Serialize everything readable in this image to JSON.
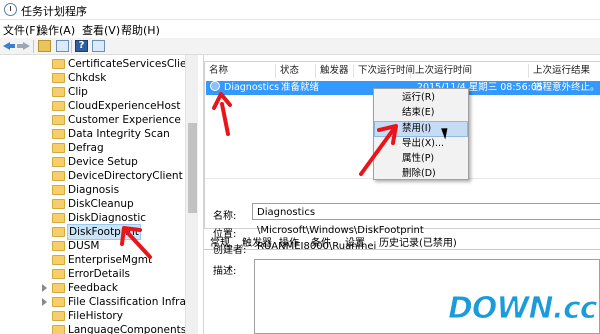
{
  "window": {
    "title": "任务计划程序"
  },
  "menu": [
    "文件(F)",
    "操作(A)",
    "查看(V)",
    "帮助(H)"
  ],
  "toolbar": {
    "help_label": "?"
  },
  "tree": [
    "CertificateServicesClient",
    "Chkdsk",
    "Clip",
    "CloudExperienceHost",
    "Customer Experience Improv",
    "Data Integrity Scan",
    "Defrag",
    "Device Setup",
    "DeviceDirectoryClient",
    "Diagnosis",
    "DiskCleanup",
    "DiskDiagnostic",
    "DiskFootprint",
    "DUSM",
    "EnterpriseMgmt",
    "ErrorDetails",
    "Feedback",
    "File Classification Infrastructu",
    "FileHistory",
    "LanguageComponentsInstall"
  ],
  "tree_selected": "DiskFootprint",
  "columns": [
    "名称",
    "状态",
    "触发器",
    "下次运行时间",
    "上次运行时间",
    "上次运行结果"
  ],
  "task": {
    "name": "Diagnostics",
    "status": "准备就绪",
    "last_run": "2015/11/4 星期三 08:56:05",
    "last_result": "进程意外终止。"
  },
  "context_menu": [
    "运行(R)",
    "结束(E)",
    "禁用(I)",
    "导出(X)...",
    "属性(P)",
    "删除(D)"
  ],
  "context_menu_highlighted": "禁用(I)",
  "tabs": [
    "常规",
    "触发器",
    "操作",
    "条件",
    "设置",
    "历史记录(已禁用)"
  ],
  "details": {
    "name_label": "名称:",
    "name_value": "Diagnostics",
    "location_label": "位置:",
    "location_value": "\\Microsoft\\Windows\\DiskFootprint",
    "author_label": "创建者:",
    "author_value": "RUANMEI8000\\Ruanmei",
    "desc_label": "描述:"
  },
  "watermark": "DOWN.cc",
  "colors": {
    "selection": "#3399ff",
    "annotation": "#e8151b",
    "watermark": "#1a9bdc"
  }
}
